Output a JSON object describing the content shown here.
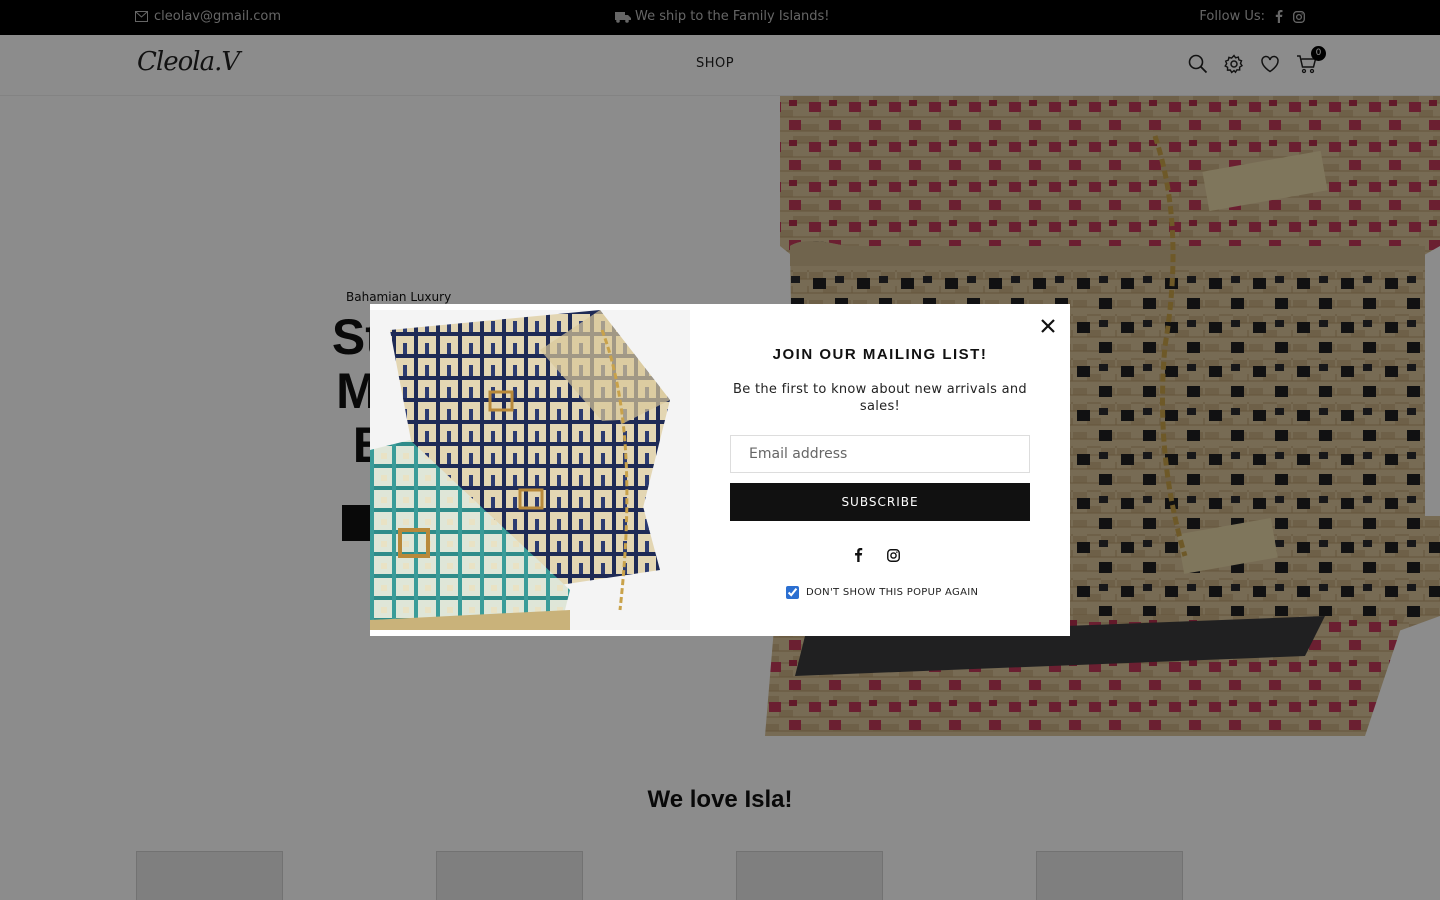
{
  "topbar": {
    "email": "cleolav@gmail.com",
    "shipping": "We ship to the Family Islands!",
    "follow_label": "Follow Us:"
  },
  "header": {
    "logo": "Cleola.V",
    "nav_shop": "SHOP",
    "cart_count": "0",
    "icons": [
      "search-icon",
      "settings-icon",
      "heart-icon",
      "cart-icon"
    ]
  },
  "hero": {
    "subtitle": "Bahamian Luxury",
    "title": "Straw Made Bah",
    "title_lines": [
      "Straw",
      "Made",
      "Bah"
    ]
  },
  "section": {
    "title": "We love Isla!"
  },
  "modal": {
    "title": "JOIN OUR MAILING LIST!",
    "text": "Be the first to know about new arrivals and sales!",
    "email_placeholder": "Email address",
    "subscribe_label": "SUBSCRIBE",
    "checkbox_label": "DON'T SHOW THIS POPUP AGAIN",
    "checkbox_checked": true
  },
  "colors": {
    "topbar_bg": "#000000",
    "button_bg": "#111111",
    "checkbox_accent": "#2b6fd1"
  }
}
